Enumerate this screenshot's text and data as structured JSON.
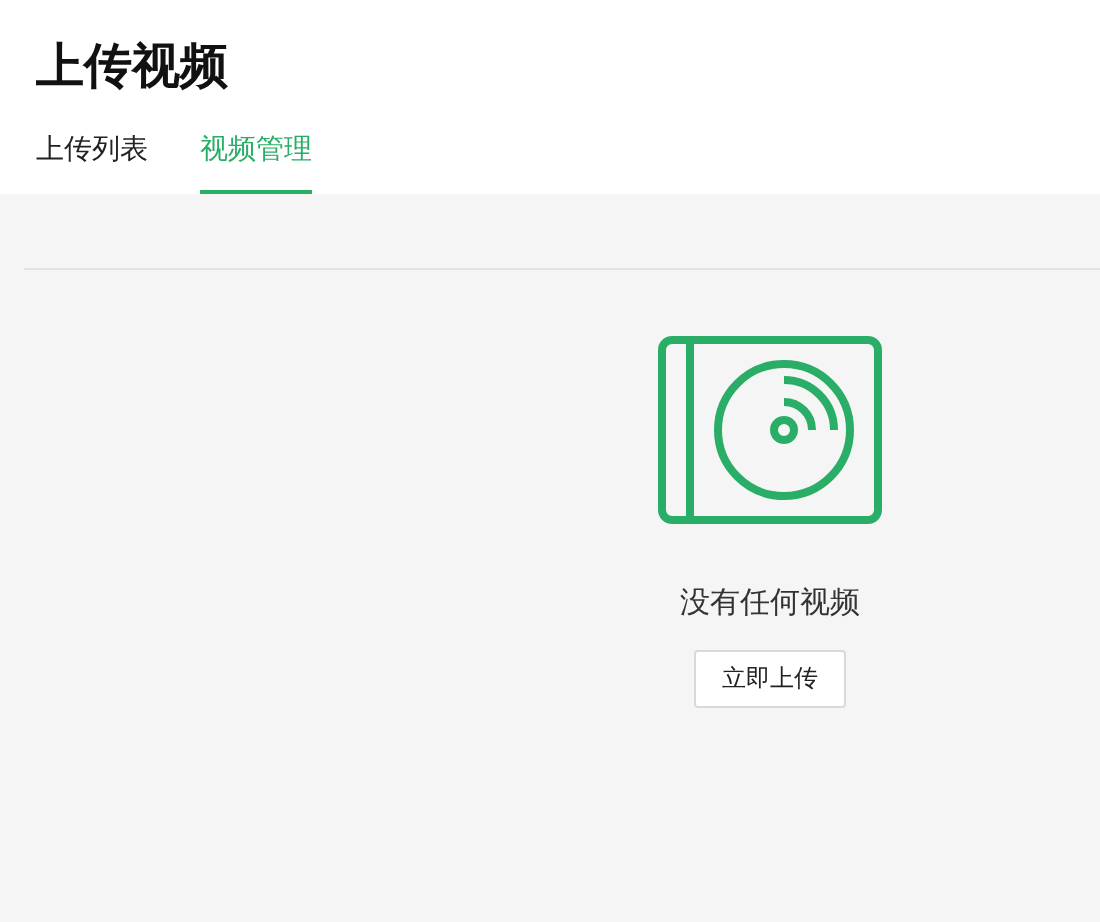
{
  "page": {
    "title": "上传视频"
  },
  "tabs": [
    {
      "label": "上传列表",
      "selected": false
    },
    {
      "label": "视频管理",
      "selected": true
    }
  ],
  "empty_state": {
    "message": "没有任何视频",
    "button": "立即上传"
  }
}
